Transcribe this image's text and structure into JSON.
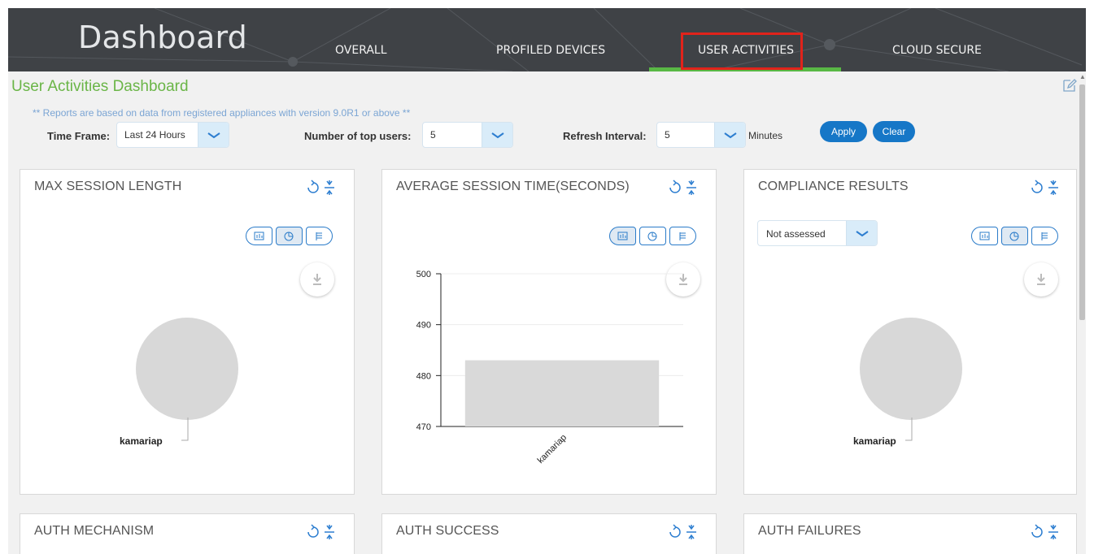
{
  "header": {
    "brand": "Dashboard",
    "tabs": [
      {
        "label": "OVERALL"
      },
      {
        "label": "PROFILED DEVICES"
      },
      {
        "label": "USER ACTIVITIES"
      },
      {
        "label": "CLOUD SECURE"
      }
    ],
    "active_tab": "USER ACTIVITIES",
    "colors": {
      "bg": "#3f4246",
      "active_underline": "#59b845",
      "highlight_box": "#e1231b"
    }
  },
  "page": {
    "title": "User Activities Dashboard",
    "note": "** Reports are based on data from registered appliances with version 9.0R1 or above **",
    "title_color": "#6ab547"
  },
  "filters": {
    "time_frame": {
      "label": "Time Frame:",
      "value": "Last 24 Hours"
    },
    "top_users": {
      "label": "Number of top users:",
      "value": "5"
    },
    "refresh": {
      "label": "Refresh Interval:",
      "value": "5",
      "unit": "Minutes"
    },
    "apply_label": "Apply",
    "clear_label": "Clear"
  },
  "panels": {
    "max_session": {
      "title": "MAX SESSION LENGTH",
      "pie_label": "kamariap",
      "chart_type": "pie"
    },
    "avg_session": {
      "title": "AVERAGE SESSION TIME(SECONDS)",
      "chart_type": "bar"
    },
    "compliance": {
      "title": "COMPLIANCE RESULTS",
      "filter_value": "Not assessed",
      "pie_label": "kamariap",
      "chart_type": "pie"
    },
    "auth_mechanism": {
      "title": "AUTH MECHANISM"
    },
    "auth_success": {
      "title": "AUTH SUCCESS"
    },
    "auth_failures": {
      "title": "AUTH FAILURES"
    }
  },
  "chart_data": {
    "type": "bar",
    "categories": [
      "kamariap"
    ],
    "values": [
      483
    ],
    "ylim": [
      470,
      500
    ],
    "yticks": [
      470,
      480,
      490,
      500
    ],
    "bar_color": "#d9d9d9"
  }
}
